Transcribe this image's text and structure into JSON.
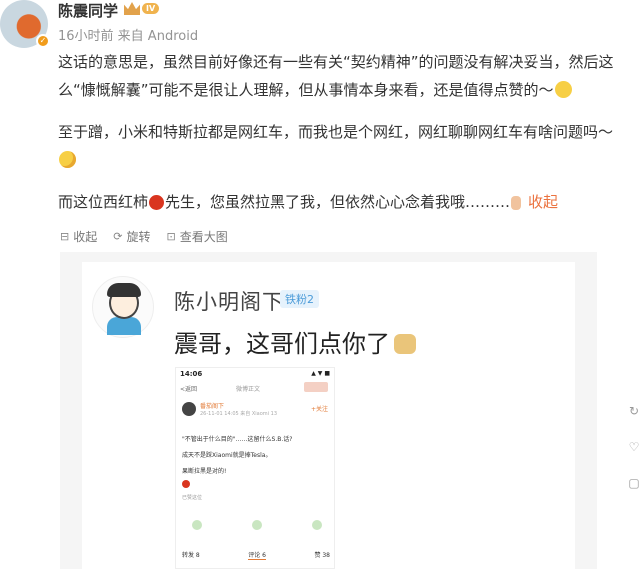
{
  "header": {
    "username": "陈震同学",
    "level_badge": "IV",
    "meta": "16小时前  来自 Android",
    "avatar_icon": "avatar-image",
    "verified_icon": "orange-verified-icon"
  },
  "post": {
    "paragraph1": "这话的意思是，虽然目前好像还有一些有关“契约精神”的问题没有解决妥当，然后这么“慷慨解囊”可能不是很让人理解，但从事情本身来看，还是值得点赞的～",
    "paragraph2": "至于蹭，小米和特斯拉都是网红车，而我也是个网红，网红聊聊网红车有啥问题吗～",
    "paragraph3_a": "而这位西红柿",
    "paragraph3_b": "先生，您虽然拉黑了我，但依然心心念着我哦………",
    "collapse_link": "收起"
  },
  "image_toolbar": {
    "collapse": "收起",
    "rotate": "旋转",
    "view_large": "查看大图"
  },
  "embedded": {
    "name": "陈小明阁下",
    "fan_badge": "铁粉2",
    "text": "震哥，这哥们点你了",
    "phone": {
      "time": "14:06",
      "status": "▲ ▼ ■",
      "back": "<返回",
      "title": "微博正文",
      "name": "番茄阁下",
      "meta": "26-11-01 14:05 来自 Xiaomi 13",
      "follow": "+关注",
      "line1": "\"不管出于什么目的\"……这留什么S.B.话?",
      "line2": "成天不是踩Xiaomi就是捧Tesla。",
      "line3": "果断拉黑是对的!",
      "action": "已赞这位",
      "bottom_left": "转发 8",
      "bottom_active": "评论 6",
      "bottom_right": "赞 38"
    }
  },
  "right_icons": [
    "refresh-icon",
    "heart-icon",
    "comment-icon"
  ],
  "colors": {
    "accent": "#eb7340",
    "muted": "#939393",
    "fan_badge": "#4b9bd8"
  }
}
